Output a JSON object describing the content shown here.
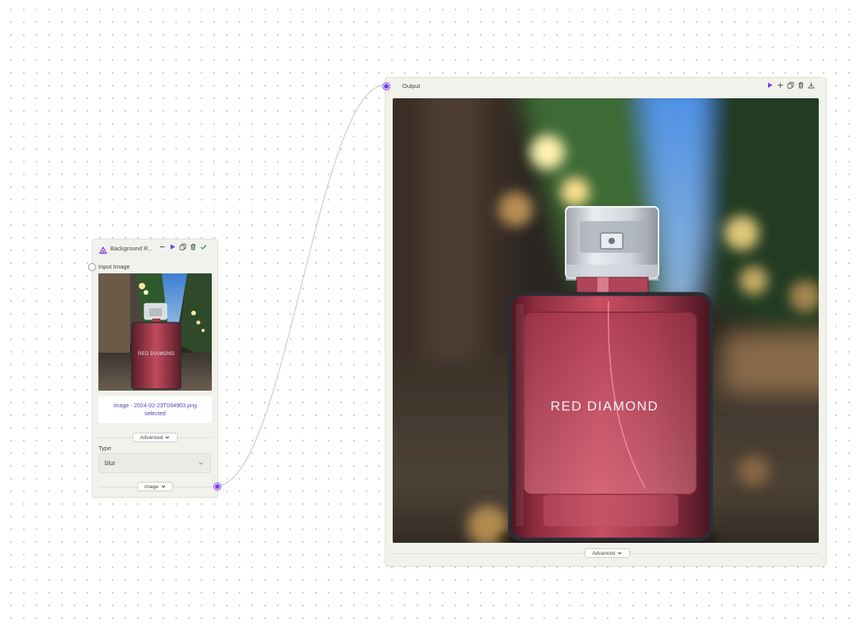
{
  "background_node": {
    "title": "Background R...",
    "input_label": "Input Image",
    "selected_file": "image - 2024-02-23T094903.png selected",
    "advanced_label": "Advanced",
    "type_label": "Type",
    "type_value": "blur",
    "output_handle_label": "image"
  },
  "output_node": {
    "title": "Output",
    "advanced_label": "Advanced"
  },
  "product": {
    "brand_text": "RED DIAMOND"
  },
  "icons": {
    "logo": "triangle-logo-icon",
    "minimize": "minus-icon",
    "run": "play-icon",
    "add": "plus-icon",
    "copy": "copy-icon",
    "delete": "trash-icon",
    "done": "check-icon",
    "download": "download-icon",
    "chevron": "chevron-down-icon"
  },
  "colors": {
    "accent": "#7c3aed",
    "success": "#22a05a",
    "node_bg": "#f2f2ec",
    "bottle": "#b53a4c"
  }
}
